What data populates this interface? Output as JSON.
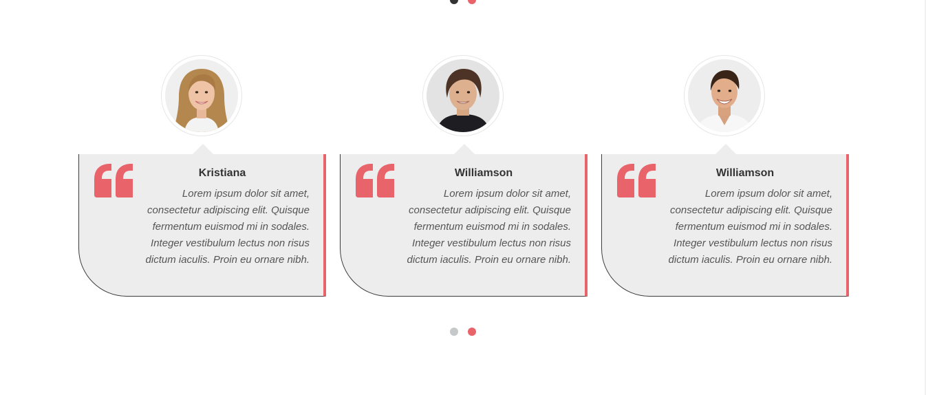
{
  "pagination_top": {
    "dots": [
      {
        "color": "#333333",
        "active": false
      },
      {
        "color": "#e8636a",
        "active": true
      }
    ]
  },
  "testimonials": [
    {
      "name": "Kristiana",
      "text": "Lorem ipsum dolor sit amet, consectetur adipiscing elit. Quisque fermentum euismod mi in sodales. Integer vestibulum lectus non risus dictum iaculis. Proin eu ornare nibh.",
      "avatar": "woman-portrait"
    },
    {
      "name": "Williamson",
      "text": "Lorem ipsum dolor sit amet, consectetur adipiscing elit. Quisque fermentum euismod mi in sodales. Integer vestibulum lectus non risus dictum iaculis. Proin eu ornare nibh.",
      "avatar": "man-portrait-dark-sweater"
    },
    {
      "name": "Williamson",
      "text": "Lorem ipsum dolor sit amet, consectetur adipiscing elit. Quisque fermentum euismod mi in sodales. Integer vestibulum lectus non risus dictum iaculis. Proin eu ornare nibh.",
      "avatar": "man-portrait-white-shirt"
    }
  ],
  "pagination_bottom": {
    "dots": [
      {
        "color": "#c6c9c9",
        "active": false
      },
      {
        "color": "#e8636a",
        "active": true
      }
    ]
  },
  "colors": {
    "accent": "#e8636a",
    "panel_bg": "#eeeded",
    "panel_outline": "#3b3b3b",
    "name_text": "#333333",
    "body_text": "#555555"
  },
  "icons": {
    "quote": "quote-icon"
  }
}
